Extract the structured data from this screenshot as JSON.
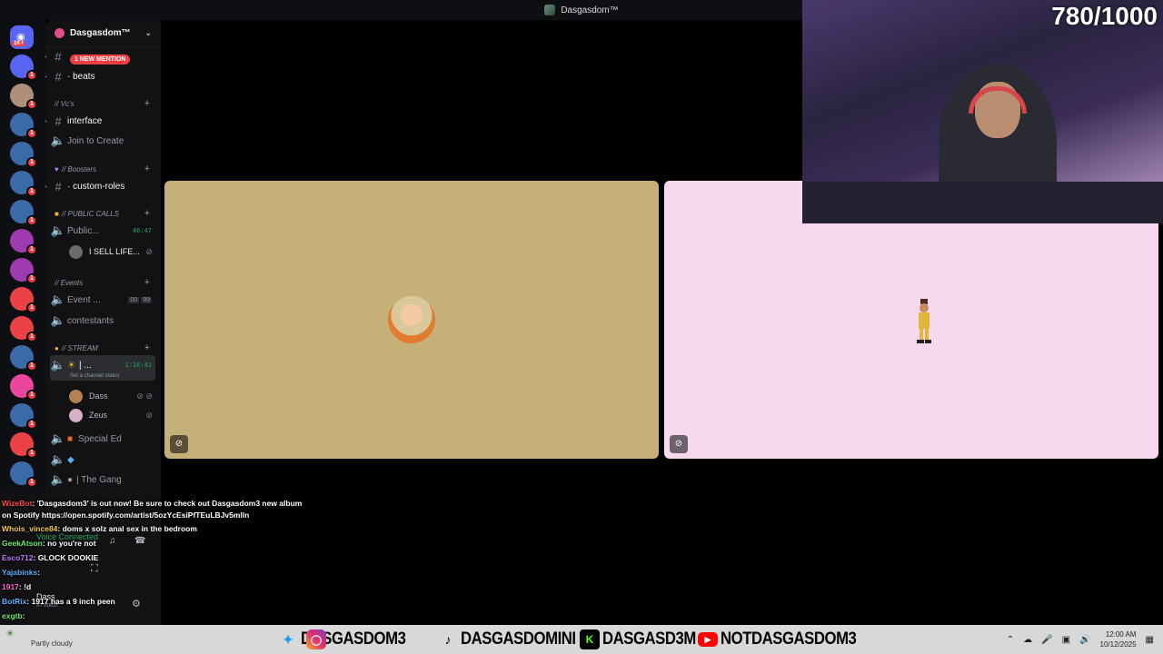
{
  "window": {
    "title": "Dasgasdom™"
  },
  "rail": {
    "home_badge": "1K+",
    "servers": [
      {
        "color": "#5865f2",
        "badge": "1"
      },
      {
        "color": "#b08f7a",
        "badge": "1"
      },
      {
        "color": "#3a6aa8",
        "badge": "1"
      },
      {
        "color": "#3a6aa8",
        "badge": "1"
      },
      {
        "color": "#3a6aa8",
        "badge": "1"
      },
      {
        "color": "#3a6aa8",
        "badge": "1"
      },
      {
        "color": "#a03ab0",
        "badge": "1"
      },
      {
        "color": "#a03ab0",
        "badge": "1"
      },
      {
        "color": "#ed4245",
        "badge": "1"
      },
      {
        "color": "#ed4245",
        "badge": "1"
      },
      {
        "color": "#3a6aa8",
        "badge": "1"
      },
      {
        "color": "#eb459e",
        "badge": "1"
      },
      {
        "color": "#3a6aa8",
        "badge": "1"
      },
      {
        "color": "#ed4245",
        "badge": "1"
      },
      {
        "color": "#3a6aa8",
        "badge": "1"
      }
    ]
  },
  "server": {
    "name": "Dasgasdom™"
  },
  "channels": {
    "mention_badge": "1 NEW MENTION",
    "beats": "· beats",
    "cat_vcs": "// Vc's",
    "interface": "interface",
    "join_to_create": "Join to Create",
    "cat_boosters": "// Boosters",
    "custom_roles": "· custom-roles",
    "cat_public": "// PUBLIC CALLS",
    "public": "Public...",
    "public_timer": "46:47",
    "public_user": "I SELL LIFE...",
    "cat_events": "// Events",
    "event": "Event ...",
    "event_count_a": "00",
    "event_count_b": "99",
    "contestants": "contestants",
    "cat_stream": "// STREAM",
    "stream_channel": "| ...",
    "stream_timer": "1:16:41",
    "stream_status": "Set a channel status",
    "user_dass": "Dass",
    "user_zeus": "Zeus",
    "special_ed": "Special Ed",
    "the_gang": "| The Gang"
  },
  "chat": [
    {
      "name": "WizeBot",
      "color": "#ff4b4b",
      "text": ": 'Dasgasdom3' is out now! Be sure to check out Dasgasdom3 new album on Spotify https://open.spotify.com/artist/5ozYcEsiPfTEuLBJv5mlln"
    },
    {
      "name": "Whois_vince84",
      "color": "#f7c84b",
      "text": ": doms x solz anal sex in the bedroom"
    },
    {
      "name": "GeekAtson",
      "color": "#6ee86e",
      "text": ": no you're not"
    },
    {
      "name": "Esco712",
      "color": "#c37bff",
      "text": ": GLOCK DOOKIE"
    },
    {
      "name": "Yajabinks",
      "color": "#5ab0ff",
      "text": ":"
    },
    {
      "name": "1917",
      "color": "#ff6ad5",
      "text": ": !d"
    },
    {
      "name": "BotRix",
      "color": "#5ab0ff",
      "text": ": 1917 has a 9 inch peen"
    },
    {
      "name": "exgtb",
      "color": "#6ee86e",
      "text": ":"
    }
  ],
  "voice_panel": {
    "status": "Voice Connected",
    "user": "Dass",
    "sub": "In voice"
  },
  "webcam": {
    "counter": "780/1000"
  },
  "social": [
    {
      "platform": "twitter-icon",
      "handle": "DASGASDOM3"
    },
    {
      "platform": "instagram-icon",
      "handle": ""
    },
    {
      "platform": "tiktok-icon",
      "handle": "DASGASDOMINI"
    },
    {
      "platform": "kick-icon",
      "handle": "DASGASD3M"
    },
    {
      "platform": "youtube-icon",
      "handle": "NOTDASGASDOM3"
    }
  ],
  "weather": "Partly cloudy",
  "clock": {
    "time": "12:00 AM",
    "date": "10/12/2025"
  }
}
